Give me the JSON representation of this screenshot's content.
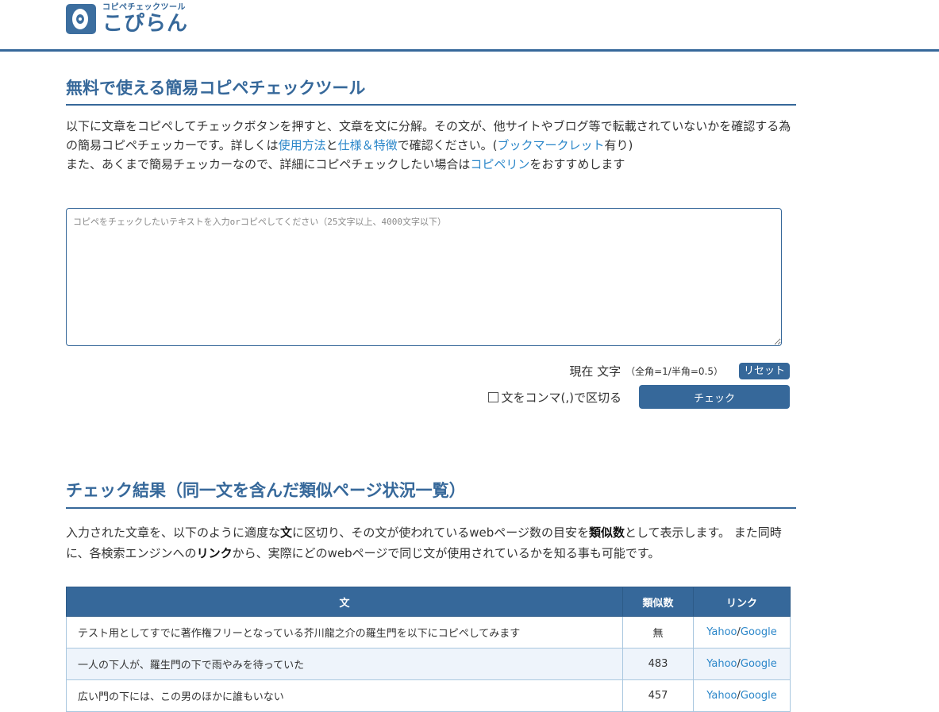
{
  "header": {
    "logo_sub": "コピペチェックツール",
    "logo_main": "こぴらん"
  },
  "main": {
    "title": "無料で使える簡易コピペチェックツール",
    "intro": {
      "p1_a": "以下に文章をコピペしてチェックボタンを押すと、文章を文に分解。その文が、他サイトやブログ等で転載されていないかを確認する為の簡易コピペチェッカーです。詳しくは",
      "link_usage": "使用方法",
      "p1_b": "と",
      "link_spec": "仕様＆特徴",
      "p1_c": "で確認ください。(",
      "link_bookmarklet": "ブックマークレット",
      "p1_d": "有り)",
      "p2_a": "また、あくまで簡易チェッカーなので、詳細にコピペチェックしたい場合は",
      "link_copiperin": "コピペリン",
      "p2_b": "をおすすめします"
    },
    "textarea_placeholder": "コピペをチェックしたいテキストを入力orコピペしてください（25文字以上、4000文字以下）",
    "count_label": "現在 文字",
    "count_note": "（全角=1/半角=0.5）",
    "reset_label": "リセット",
    "comma_split_label": "文をコンマ(,)で区切る",
    "check_button": "チェック"
  },
  "results": {
    "title": "チェック結果（同一文を含んだ類似ページ状況一覧）",
    "desc_a": "入力された文章を、以下のように適度な",
    "desc_bold1": "文",
    "desc_b": "に区切り、その文が使われているwebページ数の目安を",
    "desc_bold2": "類似数",
    "desc_c": "として表示します。 また同時に、各検索エンジンへの",
    "desc_bold3": "リンク",
    "desc_d": "から、実際にどのwebページで同じ文が使用されているかを知る事も可能です。",
    "columns": [
      "文",
      "類似数",
      "リンク"
    ],
    "rows": [
      {
        "text": "テスト用としてすでに著作権フリーとなっている芥川龍之介の羅生門を以下にコピペしてみます",
        "count": "無",
        "yahoo": "Yahoo",
        "sep": "/",
        "google": "Google"
      },
      {
        "text": "一人の下人が、羅生門の下で雨やみを待っていた",
        "count": "483",
        "yahoo": "Yahoo",
        "sep": "/",
        "google": "Google"
      },
      {
        "text": "広い門の下には、この男のほかに誰もいない",
        "count": "457",
        "yahoo": "Yahoo",
        "sep": "/",
        "google": "Google"
      }
    ]
  }
}
